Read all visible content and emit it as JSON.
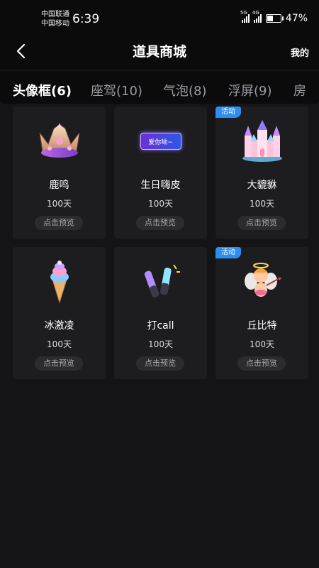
{
  "status_bar": {
    "carrier_1": "中国联通",
    "carrier_2": "中国移动",
    "time": "6:39",
    "net_1": "5G",
    "net_2": "4G",
    "battery": "47%",
    "battery_level": 0.47
  },
  "header": {
    "title": "道具商城",
    "mine_label": "我的"
  },
  "tabs": [
    {
      "label": "头像框(6)",
      "active": true
    },
    {
      "label": "座驾(10)",
      "active": false
    },
    {
      "label": "气泡(8)",
      "active": false
    },
    {
      "label": "浮屏(9)",
      "active": false
    },
    {
      "label": "房",
      "active": false
    }
  ],
  "items": [
    {
      "name": "鹿鸣",
      "duration": "100天",
      "preview": "点击预览",
      "badge": "",
      "icon": "crown-icon"
    },
    {
      "name": "生日嗨皮",
      "duration": "100天",
      "preview": "点击预览",
      "badge": "",
      "icon": "nameplate-icon",
      "icon_text": "爱你呦~"
    },
    {
      "name": "大貔貅",
      "duration": "100天",
      "preview": "点击预览",
      "badge": "活动",
      "icon": "castle-icon"
    },
    {
      "name": "冰激凌",
      "duration": "100天",
      "preview": "点击预览",
      "badge": "",
      "icon": "ice-cream-icon"
    },
    {
      "name": "打call",
      "duration": "100天",
      "preview": "点击预览",
      "badge": "",
      "icon": "glowstick-icon"
    },
    {
      "name": "丘比特",
      "duration": "100天",
      "preview": "点击预览",
      "badge": "活动",
      "icon": "cupid-icon"
    }
  ]
}
